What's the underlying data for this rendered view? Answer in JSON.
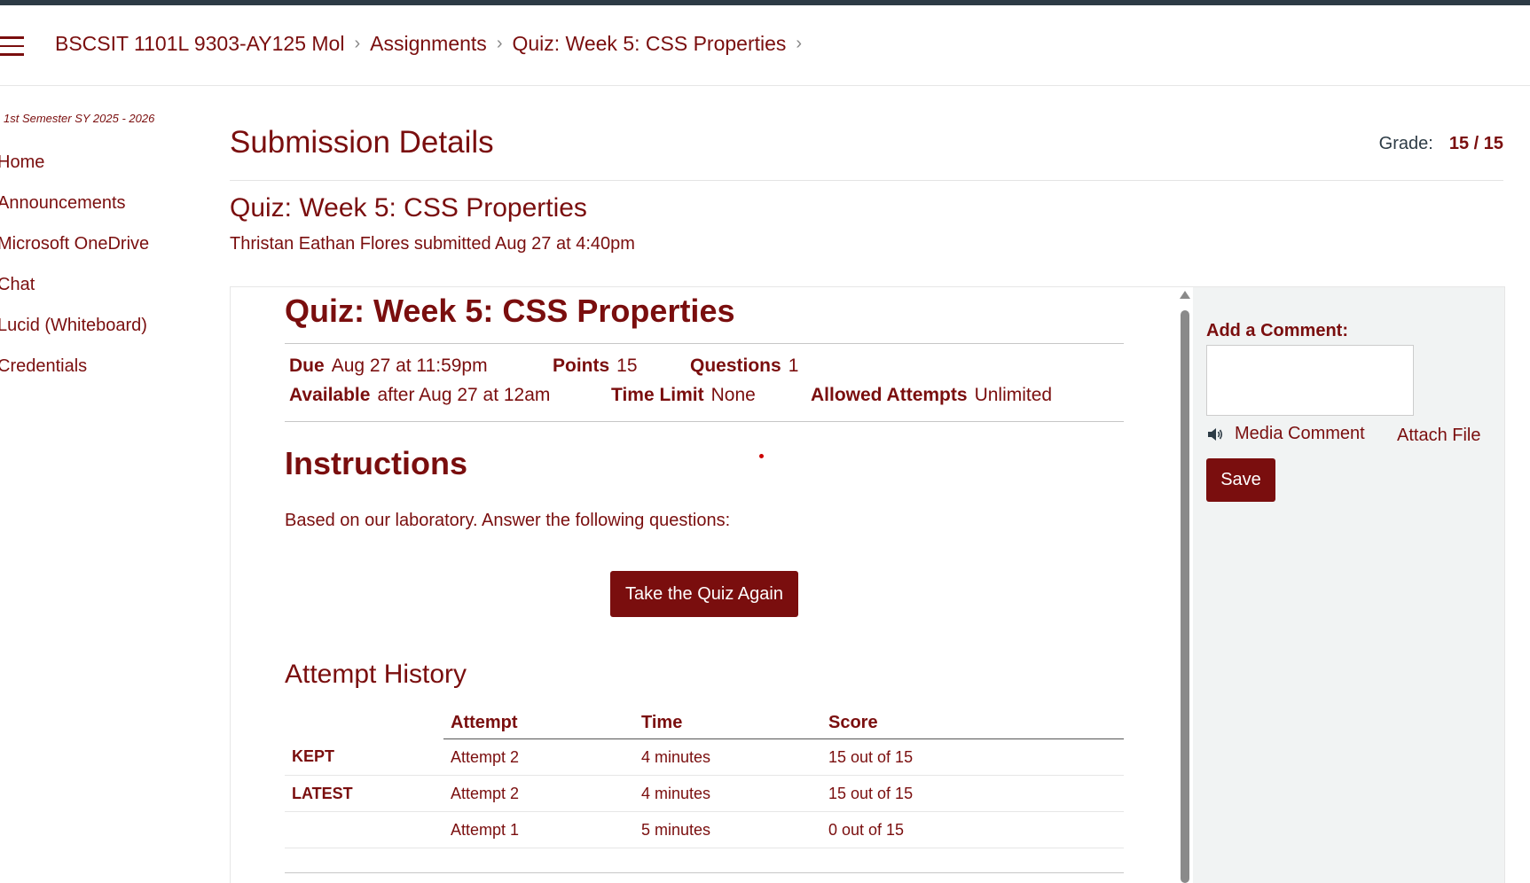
{
  "breadcrumb": {
    "items": [
      "BSCSIT 1101L 9303-AY125 Mol",
      "Assignments",
      "Quiz: Week 5: CSS Properties"
    ],
    "separator": "›"
  },
  "sidebar": {
    "term": "1st Semester SY 2025 - 2026",
    "items": [
      "Home",
      "Announcements",
      "Microsoft OneDrive",
      "Chat",
      "Lucid (Whiteboard)",
      "Credentials"
    ]
  },
  "page": {
    "title": "Submission Details",
    "grade_label": "Grade:",
    "grade_value": "15 / 15",
    "quiz_link": "Quiz: Week 5: CSS Properties",
    "submitted_text": "Thristan Eathan Flores submitted Aug 27 at 4:40pm"
  },
  "quiz": {
    "heading": "Quiz: Week 5: CSS Properties",
    "due_label": "Due",
    "due_value": "Aug 27 at 11:59pm",
    "points_label": "Points",
    "points_value": "15",
    "questions_label": "Questions",
    "questions_value": "1",
    "available_label": "Available",
    "available_value": "after Aug 27 at 12am",
    "time_limit_label": "Time Limit",
    "time_limit_value": "None",
    "attempts_label": "Allowed Attempts",
    "attempts_value": "Unlimited",
    "instructions_heading": "Instructions",
    "instructions_text": "Based on our laboratory. Answer the following questions:",
    "retake_label": "Take the Quiz Again",
    "attempt_history_heading": "Attempt History",
    "history_columns": [
      "",
      "Attempt",
      "Time",
      "Score"
    ],
    "history_rows": [
      [
        "KEPT",
        "Attempt 2",
        "4 minutes",
        "15 out of 15"
      ],
      [
        "LATEST",
        "Attempt 2",
        "4 minutes",
        "15 out of 15"
      ],
      [
        "",
        "Attempt 1",
        "5 minutes",
        "0 out of 15"
      ]
    ]
  },
  "comment_panel": {
    "label": "Add a Comment:",
    "media_comment": "Media Comment",
    "attach_file": "Attach File",
    "save_label": "Save"
  },
  "colors": {
    "accent": "#7a0e0e",
    "topbar": "#2d3b45",
    "panel_bg": "#f1f3f3"
  },
  "icons": [
    "hamburger-menu-icon",
    "chevron-right-icon",
    "speaker-icon"
  ]
}
